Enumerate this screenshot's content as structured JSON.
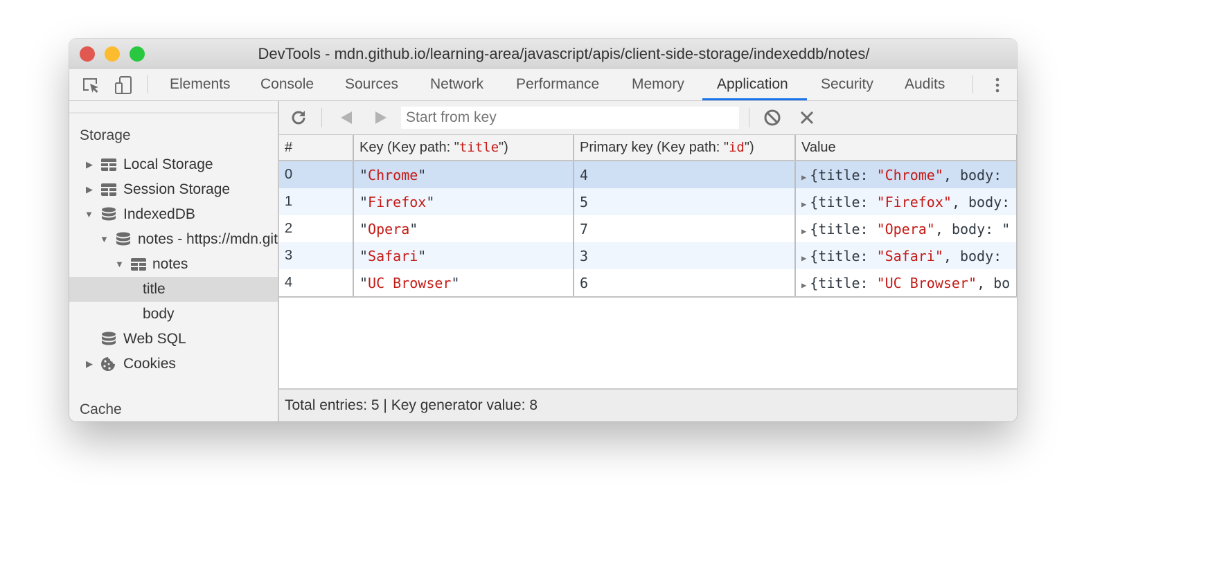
{
  "window": {
    "title": "DevTools - mdn.github.io/learning-area/javascript/apis/client-side-storage/indexeddb/notes/",
    "traffic_lights": {
      "close": "#e0584f",
      "minimize": "#fdbb2f",
      "maximize": "#29c840"
    }
  },
  "toolbar_icons": {
    "inspect": "inspect-element-icon",
    "device": "device-toggle-icon",
    "more": "kebab-menu-icon"
  },
  "tabs": [
    {
      "label": "Elements",
      "active": false
    },
    {
      "label": "Console",
      "active": false
    },
    {
      "label": "Sources",
      "active": false
    },
    {
      "label": "Network",
      "active": false
    },
    {
      "label": "Performance",
      "active": false
    },
    {
      "label": "Memory",
      "active": false
    },
    {
      "label": "Application",
      "active": true
    },
    {
      "label": "Security",
      "active": false
    },
    {
      "label": "Audits",
      "active": false
    }
  ],
  "accent_color": "#1a73e8",
  "sidebar": {
    "storage_heading": "Storage",
    "items": [
      {
        "label": "Local Storage",
        "icon": "table-grid-icon",
        "expanded": false
      },
      {
        "label": "Session Storage",
        "icon": "table-grid-icon",
        "expanded": false
      },
      {
        "label": "IndexedDB",
        "icon": "database-icon",
        "expanded": true
      },
      {
        "label": "notes - https://mdn.github.io",
        "icon": "database-icon",
        "expanded": true
      },
      {
        "label": "notes",
        "icon": "table-grid-icon",
        "expanded": true
      },
      {
        "label": "title",
        "selected": true
      },
      {
        "label": "body"
      },
      {
        "label": "Web SQL",
        "icon": "database-icon"
      },
      {
        "label": "Cookies",
        "icon": "cookie-icon",
        "expanded": false
      }
    ],
    "cache_heading": "Cache"
  },
  "data_toolbar": {
    "refresh": "refresh-icon",
    "prev": "previous-page-icon",
    "next": "next-page-icon",
    "start_key_placeholder": "Start from key",
    "start_key_value": "",
    "clear": "clear-object-store-icon",
    "delete": "delete-selected-icon"
  },
  "table": {
    "columns": {
      "index": "#",
      "key_prefix": "Key (Key path: \"",
      "key_path": "title",
      "key_suffix": "\")",
      "primary_prefix": "Primary key (Key path: \"",
      "primary_path": "id",
      "primary_suffix": "\")",
      "value": "Value"
    },
    "rows": [
      {
        "index": "0",
        "key": "Chrome",
        "primary_key": "4",
        "value_title": "Chrome",
        "value_rest": ", body: "
      },
      {
        "index": "1",
        "key": "Firefox",
        "primary_key": "5",
        "value_title": "Firefox",
        "value_rest": ", body: "
      },
      {
        "index": "2",
        "key": "Opera",
        "primary_key": "7",
        "value_title": "Opera",
        "value_rest": ", body: \""
      },
      {
        "index": "3",
        "key": "Safari",
        "primary_key": "3",
        "value_title": "Safari",
        "value_rest": ", body: "
      },
      {
        "index": "4",
        "key": "UC Browser",
        "primary_key": "6",
        "value_title": "UC Browser",
        "value_rest": ", bo"
      }
    ],
    "selected_row": 0,
    "value_prefix": "{title: "
  },
  "footer": {
    "text": "Total entries: 5 | Key generator value: 8"
  }
}
